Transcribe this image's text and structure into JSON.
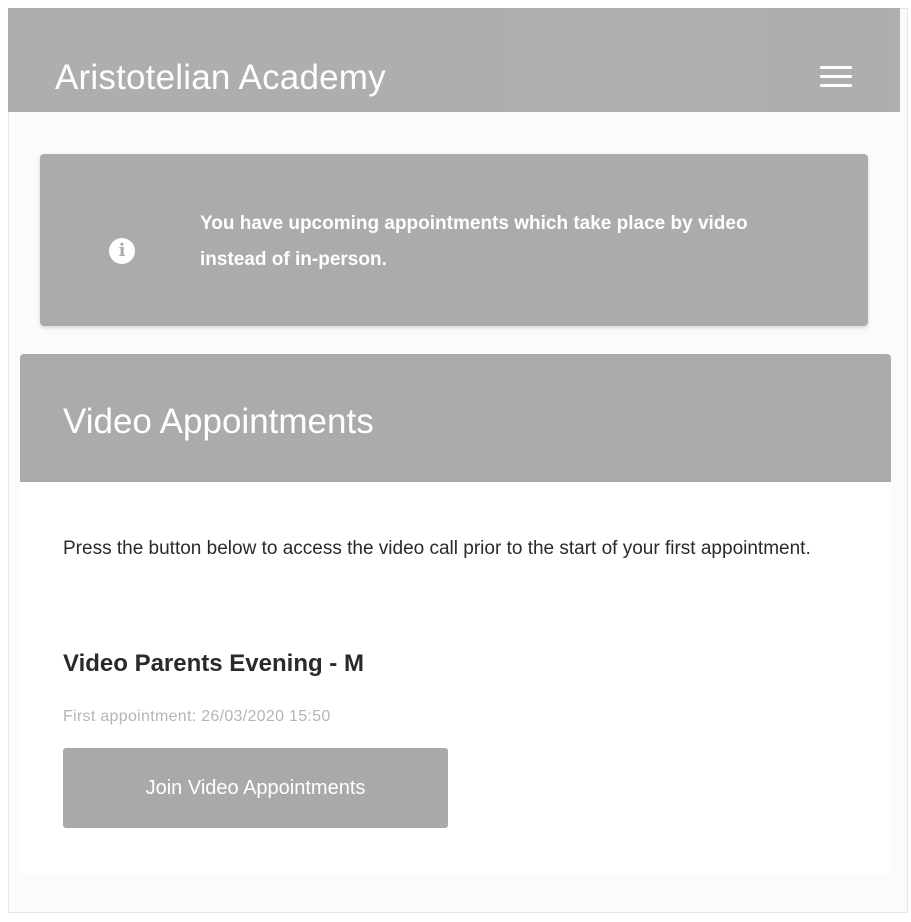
{
  "app": {
    "title": "Aristotelian Academy"
  },
  "header": {
    "menu_icon": "hamburger-menu-icon"
  },
  "alert": {
    "icon": "info-icon",
    "icon_glyph": "i",
    "message": "You have upcoming appointments which take place by video instead of in-person."
  },
  "video_card": {
    "title": "Video Appointments",
    "intro": "Press the button below to access the video call prior to the start of your first appointment.",
    "event_name": "Video Parents Evening - M",
    "first_appointment": "First appointment: 26/03/2020 15:50",
    "join_button_label": "Join Video Appointments"
  },
  "colors": {
    "header_bg": "#a9a9a9",
    "alert_bg": "#a7a7a7",
    "button_bg": "#a9a9a9",
    "text_dark": "#2a2a2a",
    "text_muted": "#b5b5b5"
  }
}
